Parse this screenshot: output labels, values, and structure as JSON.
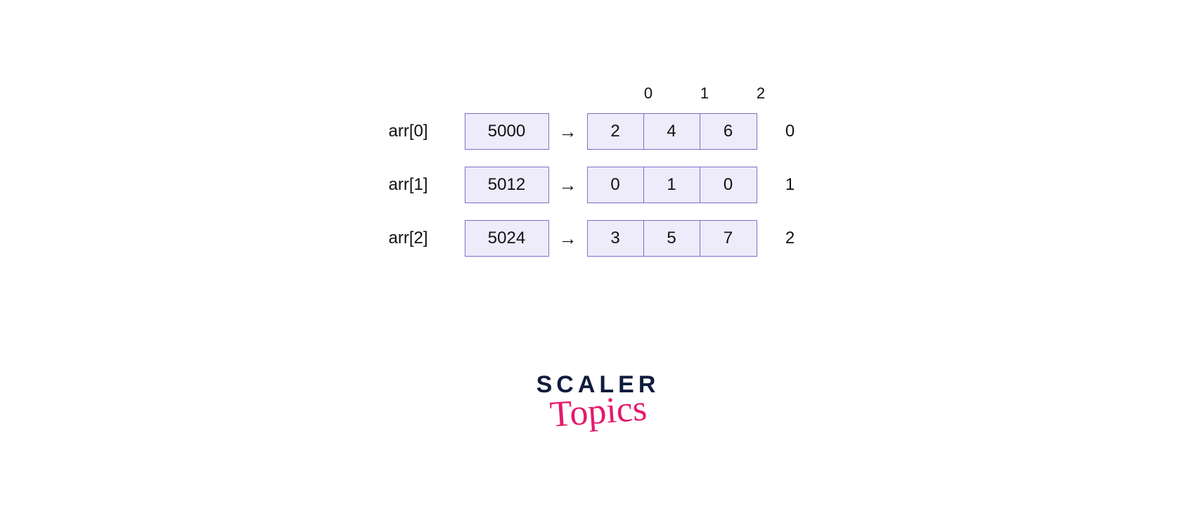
{
  "column_headers": [
    "0",
    "1",
    "2"
  ],
  "rows": [
    {
      "label": "arr[0]",
      "pointer": "5000",
      "data": [
        "2",
        "4",
        "6"
      ],
      "index": "0"
    },
    {
      "label": "arr[1]",
      "pointer": "5012",
      "data": [
        "0",
        "1",
        "0"
      ],
      "index": "1"
    },
    {
      "label": "arr[2]",
      "pointer": "5024",
      "data": [
        "3",
        "5",
        "7"
      ],
      "index": "2"
    }
  ],
  "arrow_glyph": "→",
  "logo": {
    "top": "SCALER",
    "bottom": "Topics"
  }
}
